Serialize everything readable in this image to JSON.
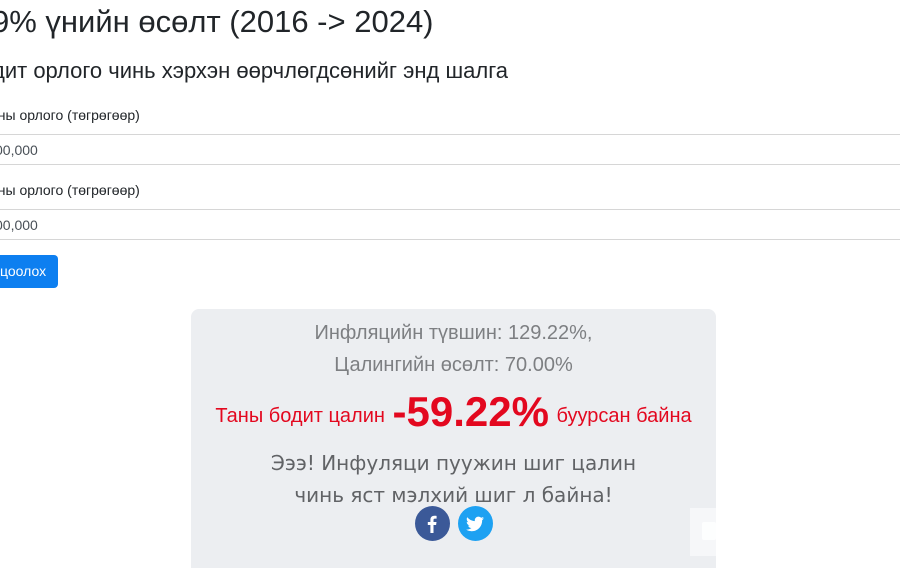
{
  "header": {
    "title": "9% үнийн өсөлт (2016 -> 2024)",
    "subtitle": "дит орлого чинь хэрхэн өөрчлөгдсөнийг энд шалга"
  },
  "form": {
    "field1": {
      "label": "оны орлого (төгрөгөөр)",
      "value": "00,000"
    },
    "field2": {
      "label": "оны орлого (төгрөгөөр)",
      "value": "00,000"
    },
    "calculate_label": "цоолох"
  },
  "result": {
    "inflation_line": "Инфляцийн түвшин: 129.22%,",
    "wage_line": "Цалингийн өсөлт: 70.00%",
    "main_prefix": "Таны бодит цалин",
    "main_value": "-59.22%",
    "main_suffix": "буурсан байна",
    "joke": "Эээ! Инфуляци пуужин шиг цалин чинь яст мэлхий шиг л байна!",
    "share": [
      {
        "icon": "facebook-icon",
        "color": "#3b5998"
      },
      {
        "icon": "twitter-icon",
        "color": "#1da1f2"
      }
    ]
  },
  "colors": {
    "primary": "#0d7ff0",
    "negative": "#e3081f",
    "card_bg": "#eceef1"
  }
}
